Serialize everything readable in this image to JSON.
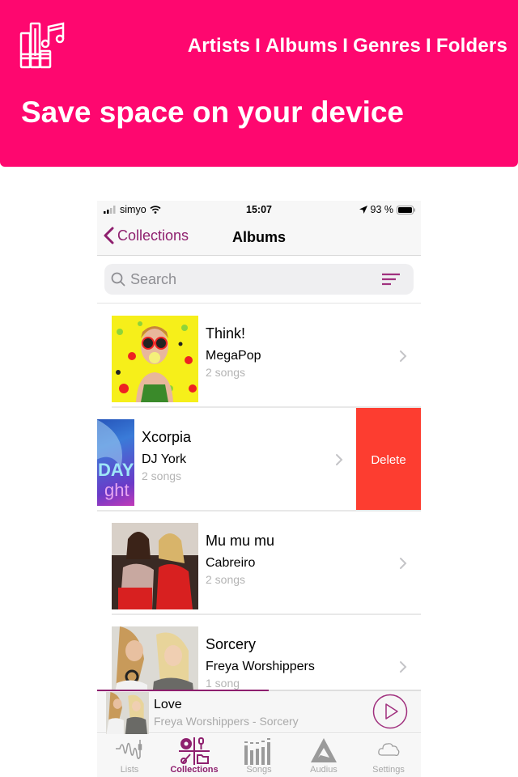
{
  "banner": {
    "tabs": [
      "Artists",
      "Albums",
      "Genres",
      "Folders"
    ],
    "separator": "I",
    "title": "Save space on your device",
    "color": "#fe076f"
  },
  "statusbar": {
    "carrier": "simyo",
    "time": "15:07",
    "battery": "93 %"
  },
  "navbar": {
    "back_label": "Collections",
    "title": "Albums",
    "accent": "#8e1f6e"
  },
  "search": {
    "placeholder": "Search",
    "value": ""
  },
  "albums": [
    {
      "title": "Think!",
      "artist": "MegaPop",
      "count": "2 songs"
    },
    {
      "title": "Xcorpia",
      "artist": "DJ York",
      "count": "2 songs",
      "swiped": true
    },
    {
      "title": "Mu mu mu",
      "artist": "Cabreiro",
      "count": "2 songs"
    },
    {
      "title": "Sorcery",
      "artist": "Freya Worshippers",
      "count": "1 song"
    }
  ],
  "row_action": {
    "delete_label": "Delete",
    "color": "#fd3d30"
  },
  "player": {
    "title": "Love",
    "subtitle": "Freya Worshippers - Sorcery",
    "progress": 0.53
  },
  "tabbar": {
    "items": [
      {
        "label": "Lists",
        "icon": "waveform-cable-icon",
        "active": false
      },
      {
        "label": "Collections",
        "icon": "collections-grid-icon",
        "active": true
      },
      {
        "label": "Songs",
        "icon": "equalizer-bars-icon",
        "active": false
      },
      {
        "label": "Audius",
        "icon": "audius-logo-icon",
        "active": false
      },
      {
        "label": "Settings",
        "icon": "cloud-icon",
        "active": false
      }
    ]
  }
}
